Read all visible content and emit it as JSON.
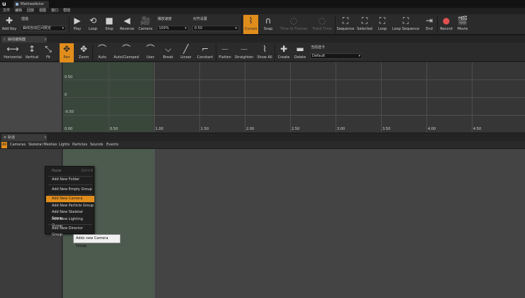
{
  "title_bar": {
    "logo": "u",
    "doc_tab": "MatineeActor"
  },
  "menu": [
    "文件",
    "编辑",
    "回放",
    "视图",
    "窗口",
    "帮助"
  ],
  "toolbar": {
    "add_key": "Add Key",
    "interp_mode_label": "插值",
    "interp_mode_value": "曲线自动区间限定",
    "play": "Play",
    "loop": "Loop",
    "stop": "Stop",
    "reverse": "Reverse",
    "camera": "Camera",
    "speed_label": "播放速度",
    "speed_value": "100%",
    "snap_label": "对齐设置",
    "snap_value": "0.50",
    "curves": "Curves",
    "snap": "Snap",
    "time_to_frames": "Time to Frames",
    "fixed_time": "Fixed Time",
    "sequence": "Sequence",
    "selected": "Selected",
    "loop2": "Loop",
    "loop_sequence": "Loop Sequence",
    "end": "End",
    "record": "Record",
    "movie": "Movie",
    "accent_color": "#e08d1c"
  },
  "curve_toolbar": {
    "horizontal": "Horizontal",
    "vertical": "Vertical",
    "fit": "Fit",
    "pan": "Pan",
    "zoom": "Zoom",
    "auto": "Auto",
    "auto_clamped": "Auto/Clamped",
    "user": "User",
    "break": "Break",
    "linear": "Linear",
    "constant": "Constant",
    "flatten": "Flatten",
    "straighten": "Straighten",
    "show_all": "Show All",
    "create": "Create",
    "delete": "Delete",
    "tab_label": "当前选卡",
    "tab_value": "Default"
  },
  "curve_panel": {
    "tab": "曲线编辑器",
    "y_labels": [
      "0.50",
      "0",
      "-0.50"
    ],
    "x_labels": [
      "0.00",
      "0.50",
      "1.00",
      "1.50",
      "2.00",
      "2.50",
      "3.00",
      "3.50",
      "4.00",
      "4.50"
    ]
  },
  "track_panel": {
    "tab": "轨道",
    "filters": [
      "All",
      "Cameras",
      "Skeletal Meshes",
      "Lights",
      "Particles",
      "Sounds",
      "Events"
    ]
  },
  "context_menu": {
    "paste": "Paste",
    "paste_shortcut": "Ctrl+V",
    "items": [
      "Add New Folder",
      "Add New Empty Group",
      "Add New Camera Group",
      "Add New Particle Group",
      "Add New Skeletal Group",
      "Add New Lighting Group",
      "Add New Director Group"
    ]
  },
  "tooltip": "Adds new Camera Group"
}
